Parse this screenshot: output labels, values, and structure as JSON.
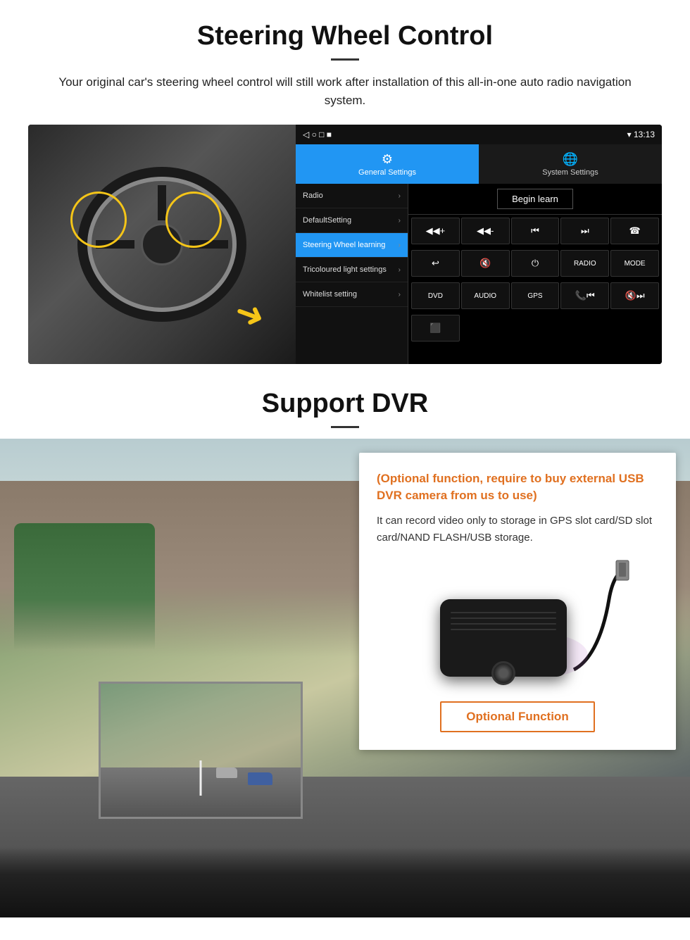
{
  "section1": {
    "title": "Steering Wheel Control",
    "subtitle": "Your original car's steering wheel control will still work after installation of this all-in-one auto radio navigation system.",
    "ui": {
      "topbar": {
        "icons": "◁  ○  □  ■",
        "status": "▾ 13:13"
      },
      "tab_active": "General Settings",
      "tab_inactive": "System Settings",
      "menu": [
        {
          "label": "Radio",
          "active": false
        },
        {
          "label": "DefaultSetting",
          "active": false
        },
        {
          "label": "Steering Wheel learning",
          "active": true
        },
        {
          "label": "Tricoloured light settings",
          "active": false
        },
        {
          "label": "Whitelist setting",
          "active": false
        }
      ],
      "begin_learn_btn": "Begin learn",
      "buttons_row1": [
        "◀◀+",
        "◀◀-",
        "◀◀",
        "▶▶",
        "☎"
      ],
      "buttons_row2": [
        "↩",
        "🔇x",
        "⏻",
        "RADIO",
        "MODE"
      ],
      "buttons_row3": [
        "DVD",
        "AUDIO",
        "GPS",
        "📞◀◀",
        "🔇▶▶"
      ],
      "buttons_row4": [
        "⬛"
      ]
    }
  },
  "section2": {
    "title": "Support DVR",
    "card": {
      "orange_text": "(Optional function, require to buy external USB DVR camera from us to use)",
      "desc": "It can record video only to storage in GPS slot card/SD slot card/NAND FLASH/USB storage."
    },
    "optional_btn": "Optional Function"
  }
}
